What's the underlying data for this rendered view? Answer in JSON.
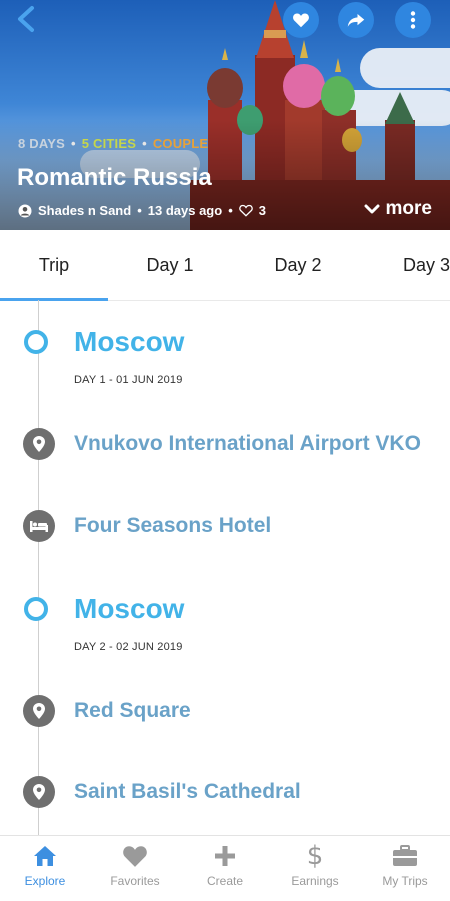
{
  "header": {
    "tags": [
      "8 DAYS",
      "5 CITIES",
      "COUPLE"
    ],
    "title": "Romantic Russia",
    "author": "Shades n Sand",
    "posted": "13 days ago",
    "likes": "3",
    "more_label": "more",
    "icons": [
      "back-arrow-icon",
      "heart-icon",
      "share-icon",
      "more-vertical-icon"
    ]
  },
  "tabs": [
    {
      "label": "Trip",
      "active": true
    },
    {
      "label": "Day 1"
    },
    {
      "label": "Day 2"
    },
    {
      "label": "Day 3"
    }
  ],
  "timeline": [
    {
      "type": "city",
      "name": "Moscow",
      "day": "DAY 1 - 01 JUN 2019"
    },
    {
      "type": "place",
      "name": "Vnukovo International Airport VKO",
      "icon": "location-pin-icon"
    },
    {
      "type": "hotel",
      "name": "Four Seasons Hotel",
      "icon": "bed-icon"
    },
    {
      "type": "city",
      "name": "Moscow",
      "day": "DAY 2 - 02 JUN 2019"
    },
    {
      "type": "place",
      "name": "Red Square",
      "icon": "location-pin-icon"
    },
    {
      "type": "place",
      "name": "Saint Basil's Cathedral",
      "icon": "location-pin-icon"
    }
  ],
  "bottom_nav": [
    {
      "label": "Explore",
      "icon": "home-icon",
      "active": true
    },
    {
      "label": "Favorites",
      "icon": "heart-icon"
    },
    {
      "label": "Create",
      "icon": "plus-icon"
    },
    {
      "label": "Earnings",
      "icon": "dollar-icon"
    },
    {
      "label": "My Trips",
      "icon": "briefcase-icon"
    }
  ],
  "colors": {
    "accent": "#42b3e8",
    "nav_active": "#3d8fe0",
    "stop_text": "#6aa2c8",
    "tag_days": "#c9d3de",
    "tag_cities": "#c6d64a",
    "tag_couple": "#e6a13a"
  }
}
